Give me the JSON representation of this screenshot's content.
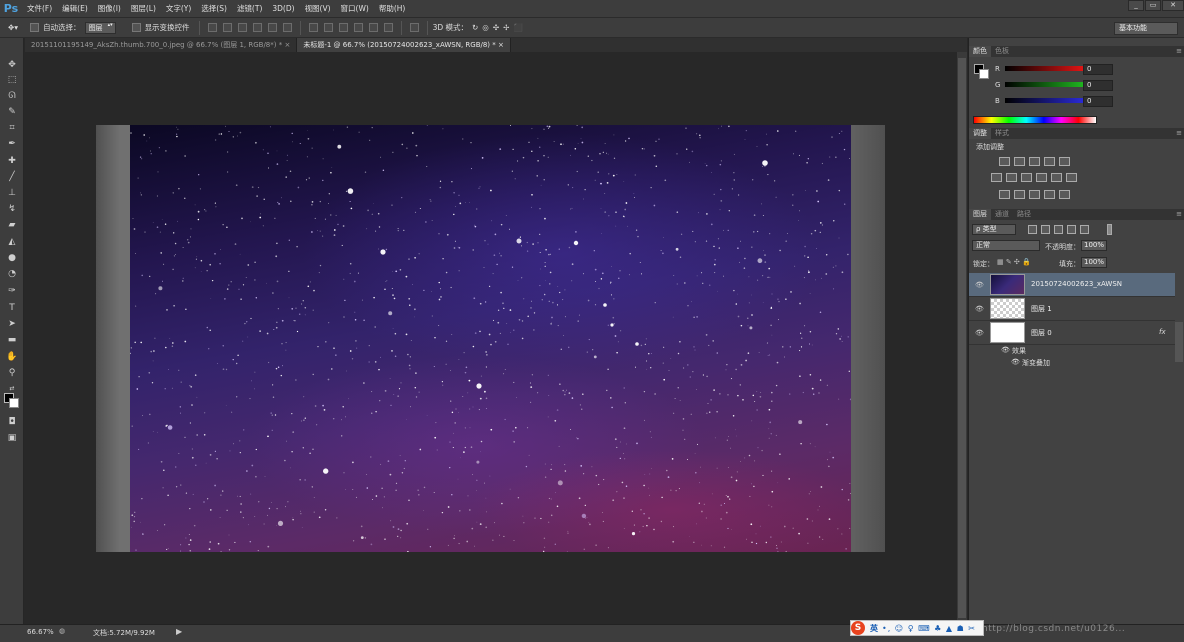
{
  "app": {
    "logo": "Ps"
  },
  "menu": [
    "文件(F)",
    "编辑(E)",
    "图像(I)",
    "图层(L)",
    "文字(Y)",
    "选择(S)",
    "滤镜(T)",
    "3D(D)",
    "视图(V)",
    "窗口(W)",
    "帮助(H)"
  ],
  "window_controls": {
    "minimize": "_",
    "restore": "▭",
    "close": "✕"
  },
  "options_bar": {
    "tool_icon": "move-tool",
    "auto_select_label": "自动选择：",
    "auto_select_target": "图层",
    "show_transform_label": "显示变换控件",
    "mode_3d_label": "3D 模式：",
    "workspace": "基本功能"
  },
  "tabs": [
    {
      "label": "20151101195149_AksZh.thumb.700_0.jpeg @ 66.7% (图层 1, RGB/8*) *",
      "close": "×",
      "active": false
    },
    {
      "label": "未标题-1 @ 66.7% (20150724002623_xAWSN, RGB/8) *",
      "close": "×",
      "active": true
    }
  ],
  "status": {
    "zoom": "66.67%",
    "doc_info": "文档:5.72M/9.92M",
    "arrow": "▶"
  },
  "ime": {
    "logo": "S",
    "lang": "英",
    "icons": "•, ☺ ♀ ⌨ ♣ ▲ ☗ ✂"
  },
  "watermark": "http://blog.csdn.net/u0126...",
  "color_panel": {
    "tabs": [
      "颜色",
      "色板"
    ],
    "channels": [
      {
        "label": "R",
        "value": "0",
        "color": "#e01414"
      },
      {
        "label": "G",
        "value": "0",
        "color": "#1fb41f"
      },
      {
        "label": "B",
        "value": "0",
        "color": "#2a2ad6"
      }
    ]
  },
  "adjust_panel": {
    "tabs": [
      "调整",
      "样式"
    ],
    "title": "添加调整"
  },
  "layers_panel": {
    "tabs": [
      "图层",
      "通道",
      "路径"
    ],
    "filter": "ρ 类型",
    "blend_mode": "正常",
    "opacity_label": "不透明度：",
    "opacity": "100%",
    "lock_label": "锁定：",
    "fill_label": "填充：",
    "fill": "100%",
    "layers": [
      {
        "name": "20150724002623_xAWSN",
        "selected": true
      },
      {
        "name": "图层 1",
        "selected": false
      },
      {
        "name": "图层 0",
        "selected": false,
        "fx": "fx"
      }
    ],
    "effects_label": "效果",
    "effect_item": "渐变叠加"
  }
}
